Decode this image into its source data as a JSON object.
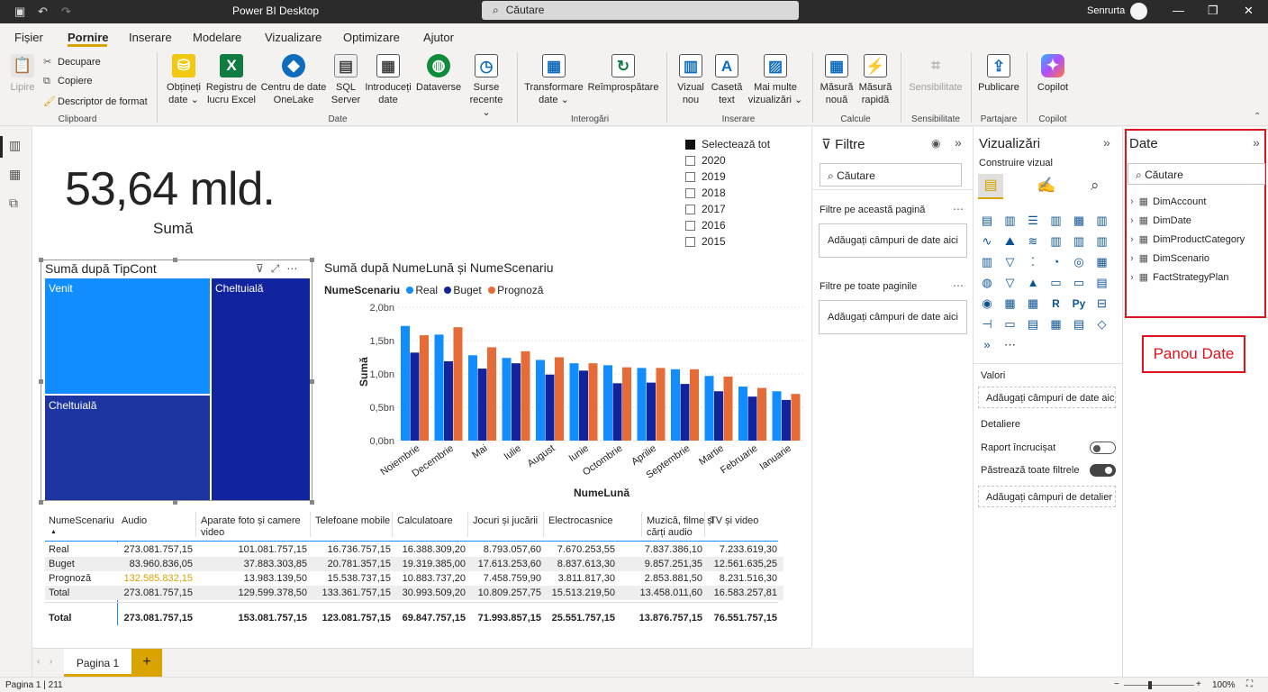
{
  "titlebar": {
    "app_title": "Power BI Desktop",
    "search_placeholder": "Căutare",
    "user": "Senrurta"
  },
  "menu": [
    "Fișier",
    "Pornire",
    "Inserare",
    "Modelare",
    "Vizualizare",
    "Optimizare",
    "Ajutor"
  ],
  "ribbon": {
    "clipboard": {
      "paste": "Lipire",
      "cut": "Decupare",
      "copy": "Copiere",
      "format_painter": "Descriptor de format",
      "label": "Clipboard"
    },
    "data": {
      "get_data": "Obțineți date",
      "excel": "Registru de lucru Excel",
      "onelake": "Centru de date OneLake",
      "sql": "SQL Server",
      "enter_data": "Introduceți date",
      "dataverse": "Dataverse",
      "recent": "Surse recente",
      "label": "Date"
    },
    "queries": {
      "transform": "Transformare date",
      "refresh": "Reîmprospătare",
      "label": "Interogări"
    },
    "insert": {
      "new_visual": "Vizual nou",
      "textbox": "Casetă text",
      "more_visuals": "Mai multe vizualizări",
      "label": "Inserare"
    },
    "calc": {
      "new_measure": "Măsură nouă",
      "quick_measure": "Măsură rapidă",
      "label": "Calcule"
    },
    "sensitivity": {
      "btn": "Sensibilitate",
      "label": "Sensibilitate"
    },
    "share": {
      "publish": "Publicare",
      "label": "Partajare"
    },
    "copilot": {
      "btn": "Copilot",
      "label": "Copilot"
    }
  },
  "kpi": {
    "value": "53,64 mld.",
    "label": "Sumă"
  },
  "slicer": {
    "items": [
      {
        "label": "Selectează tot",
        "checked": true
      },
      {
        "label": "2020",
        "checked": false
      },
      {
        "label": "2019",
        "checked": false
      },
      {
        "label": "2018",
        "checked": false
      },
      {
        "label": "2017",
        "checked": false
      },
      {
        "label": "2016",
        "checked": false
      },
      {
        "label": "2015",
        "checked": false
      }
    ]
  },
  "treemap": {
    "title": "Sumă după TipCont",
    "cells": [
      "Venit",
      "Cheltuială",
      "Cheltuială"
    ]
  },
  "chart_data": {
    "type": "bar",
    "title": "Sumă după NumeLună și NumeScenariu",
    "legend_title": "NumeScenariu",
    "xlabel": "NumeLună",
    "ylabel": "Sumă",
    "yticks": [
      "0,0bn",
      "0,5bn",
      "1,0bn",
      "1,5bn",
      "2,0bn"
    ],
    "ylim": [
      0,
      2.0
    ],
    "categories": [
      "Noiembrie",
      "Decembrie",
      "Mai",
      "Iulie",
      "August",
      "Iunie",
      "Octombrie",
      "Aprilie",
      "Septembrie",
      "Martie",
      "Februarie",
      "Ianuarie"
    ],
    "series": [
      {
        "name": "Real",
        "color": "#118dff",
        "values": [
          1.72,
          1.59,
          1.28,
          1.24,
          1.21,
          1.16,
          1.13,
          1.09,
          1.07,
          0.97,
          0.81,
          0.74
        ]
      },
      {
        "name": "Buget",
        "color": "#12239e",
        "values": [
          1.32,
          1.19,
          1.08,
          1.16,
          0.99,
          1.05,
          0.86,
          0.87,
          0.85,
          0.74,
          0.66,
          0.61
        ]
      },
      {
        "name": "Prognoză",
        "color": "#e66c37",
        "values": [
          1.58,
          1.7,
          1.4,
          1.34,
          1.25,
          1.16,
          1.1,
          1.09,
          1.07,
          0.96,
          0.79,
          0.7
        ]
      }
    ]
  },
  "matrix": {
    "headers": [
      "NumeScenariu",
      "Audio",
      "Aparate foto și camere video",
      "Telefoane mobile",
      "Calculatoare",
      "Jocuri și jucării",
      "Electrocasnice",
      "Muzică, filme și cărți audio",
      "TV și video"
    ],
    "rows": [
      {
        "label": "Real",
        "values": [
          "273.081.757,15",
          "101.081.757,15",
          "16.736.757,15",
          "16.388.309,20",
          "8.793.057,60",
          "7.670.253,55",
          "7.837.386,10",
          "7.233.619,30"
        ]
      },
      {
        "label": "Buget",
        "values": [
          "83.960.836,05",
          "37.883.303,85",
          "20.781.357,15",
          "19.319.385,00",
          "17.613.253,60",
          "8.837.613,30",
          "9.857.251,35",
          "12.561.635,25"
        ]
      },
      {
        "label": "Prognoză",
        "values": [
          "132.585.832,15",
          "13.983.139,50",
          "15.538.737,15",
          "10.883.737,20",
          "7.458.759,90",
          "3.811.817,30",
          "2.853.881,50",
          "8.231.516,30"
        ]
      },
      {
        "label": "Total",
        "values": [
          "273.081.757,15",
          "129.599.378,50",
          "133.361.757,15",
          "30.993.509,20",
          "10.809.257,75",
          "15.513.219,50",
          "13.458.011,60",
          "16.583.257,81"
        ]
      }
    ],
    "total": {
      "label": "Total",
      "values": [
        "273.081.757,15",
        "153.081.757,15",
        "123.081.757,15",
        "69.847.757,15",
        "71.993.857,15",
        "25.551.757,15",
        "13.876.757,15",
        "76.551.757,15"
      ]
    }
  },
  "filters": {
    "title": "Filtre",
    "search": "Căutare",
    "page_section": "Filtre pe această pagină",
    "page_drop": "Adăugați câmpuri de date aici",
    "all_section": "Filtre pe toate paginile",
    "all_drop": "Adăugați câmpuri de date aici"
  },
  "viz": {
    "title": "Vizualizări",
    "sub": "Construire vizual",
    "values_label": "Valori",
    "values_drop": "Adăugați câmpuri de date aici",
    "drill_label": "Detaliere",
    "cross_report": "Raport încrucișat",
    "keep_filters": "Păstrează toate filtrele",
    "drill_drop": "Adăugați câmpuri de detalier"
  },
  "data_pane": {
    "title": "Date",
    "search": "Căutare",
    "tables": [
      "DimAccount",
      "DimDate",
      "DimProductCategory",
      "DimScenario",
      "FactStrategyPlan"
    ]
  },
  "callout": "Panou Date",
  "pages": {
    "tab": "Pagina 1",
    "add": "+"
  },
  "status": {
    "page": "Pagina 1 | 211",
    "zoom": "100%"
  }
}
